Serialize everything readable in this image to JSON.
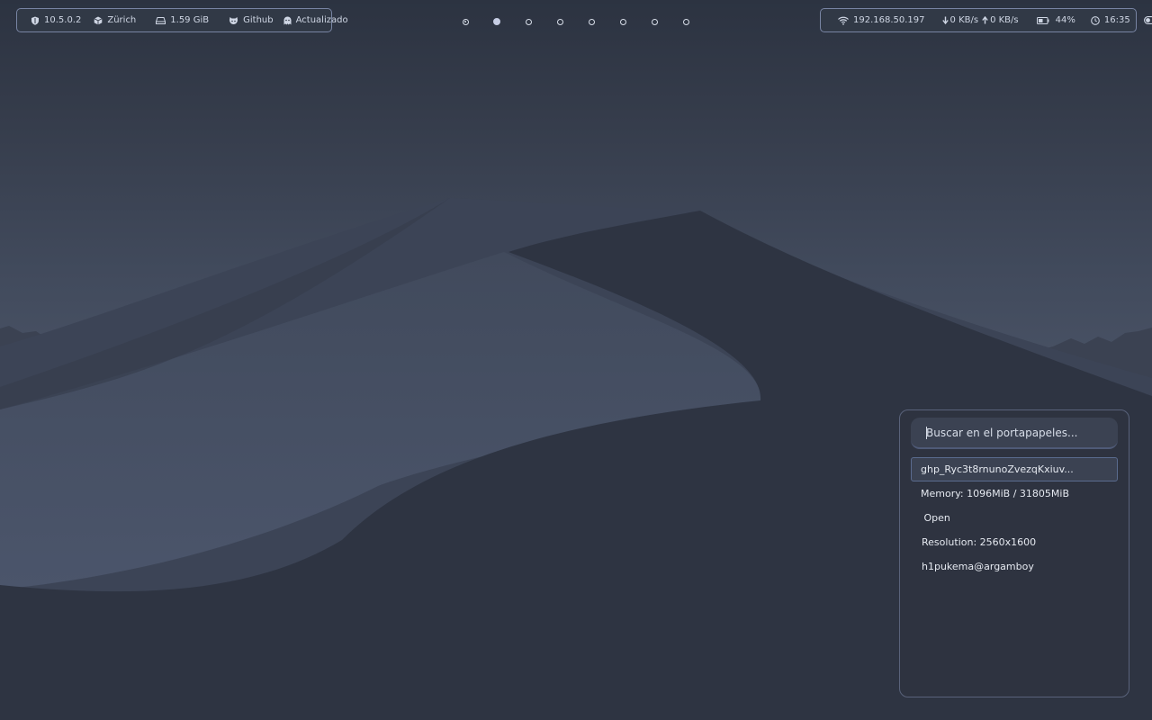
{
  "topbar": {
    "left": {
      "vpn_ip": "10.5.0.2",
      "location": "Zürich",
      "disk": "1.59 GiB",
      "github": "Github",
      "updates": "Actualizado"
    },
    "workspaces": [
      {
        "state": "focused"
      },
      {
        "state": "active"
      },
      {
        "state": "empty"
      },
      {
        "state": "empty"
      },
      {
        "state": "empty"
      },
      {
        "state": "empty"
      },
      {
        "state": "empty"
      },
      {
        "state": "empty"
      }
    ],
    "right": {
      "ip": "192.168.50.197",
      "down": "0 KB/s",
      "up": "0 KB/s",
      "battery": "44%",
      "time": "16:35"
    }
  },
  "clipboard": {
    "search_placeholder": "Buscar en el portapapeles...",
    "entries": [
      "ghp_Ryc3t8rnunoZvezqKxiuv...",
      "Memory: 1096MiB / 31805MiB",
      " Open",
      "Resolution: 2560x1600",
      "h1pukema@argamboy"
    ]
  },
  "colors": {
    "accent_border": "#7884a3",
    "panel_bg": "#2e3440",
    "text": "#d8dee9"
  },
  "icons": {
    "vpn": "shield-icon",
    "location": "cube-icon",
    "disk": "drive-icon",
    "github": "github-icon",
    "updates": "ghost-icon",
    "wifi": "wifi-icon",
    "download": "arrow-down-icon",
    "upload": "arrow-up-icon",
    "battery": "battery-icon",
    "clock": "clock-icon",
    "toggle": "toggle-icon"
  }
}
